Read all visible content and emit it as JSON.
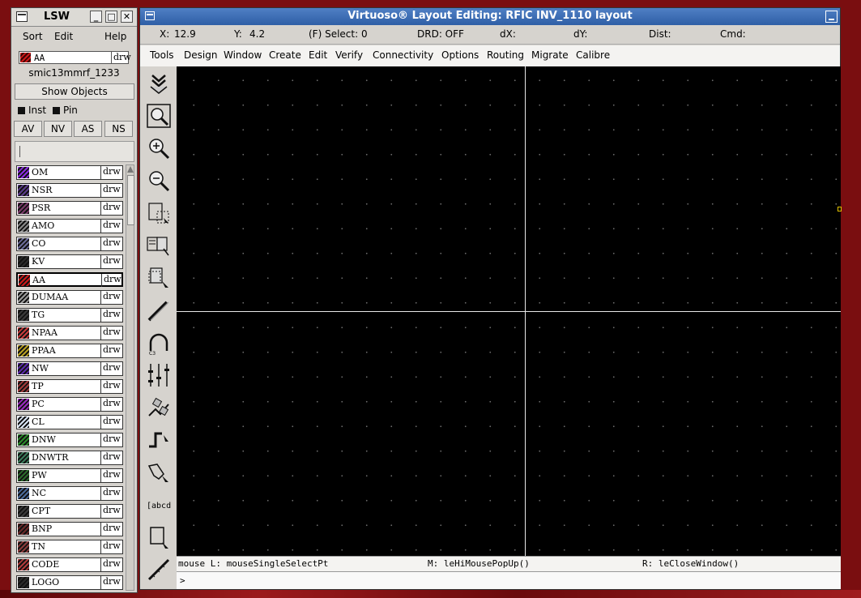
{
  "lsw": {
    "title": "LSW",
    "menu": {
      "sort": "Sort",
      "edit": "Edit",
      "help": "Help"
    },
    "current_layer": {
      "name": "AA",
      "purpose": "drw",
      "color": "#cc1a1a"
    },
    "library": "smic13mmrf_1233",
    "show_objects": "Show Objects",
    "checks": {
      "inst": "Inst",
      "pin": "Pin"
    },
    "visibility_buttons": {
      "av": "AV",
      "nv": "NV",
      "as": "AS",
      "ns": "NS"
    },
    "layers": [
      {
        "name": "OM",
        "purpose": "drw",
        "color": "#8a2be2",
        "selected": false
      },
      {
        "name": "NSR",
        "purpose": "drw",
        "color": "#5a3a8a",
        "selected": false
      },
      {
        "name": "PSR",
        "purpose": "drw",
        "color": "#7a3a6a",
        "selected": false
      },
      {
        "name": "AMO",
        "purpose": "drw",
        "color": "#888888",
        "selected": false
      },
      {
        "name": "CO",
        "purpose": "drw",
        "color": "#6a6a9a",
        "selected": false
      },
      {
        "name": "KV",
        "purpose": "drw",
        "color": "#2a2a2a",
        "selected": false
      },
      {
        "name": "AA",
        "purpose": "drw",
        "color": "#cc1a1a",
        "selected": true
      },
      {
        "name": "DUMAA",
        "purpose": "drw",
        "color": "#9a9a9a",
        "selected": false
      },
      {
        "name": "TG",
        "purpose": "drw",
        "color": "#3a3a3a",
        "selected": false
      },
      {
        "name": "NPAA",
        "purpose": "drw",
        "color": "#c83a3a",
        "selected": false
      },
      {
        "name": "PPAA",
        "purpose": "drw",
        "color": "#b8a020",
        "selected": false
      },
      {
        "name": "NW",
        "purpose": "drw",
        "color": "#5a2aaa",
        "selected": false
      },
      {
        "name": "TP",
        "purpose": "drw",
        "color": "#a03a3a",
        "selected": false
      },
      {
        "name": "PC",
        "purpose": "drw",
        "color": "#9a2ac0",
        "selected": false
      },
      {
        "name": "CL",
        "purpose": "drw",
        "color": "#d8e4f4",
        "selected": false
      },
      {
        "name": "DNW",
        "purpose": "drw",
        "color": "#2a8a2a",
        "selected": false
      },
      {
        "name": "DNWTR",
        "purpose": "drw",
        "color": "#3a7a5a",
        "selected": false
      },
      {
        "name": "PW",
        "purpose": "drw",
        "color": "#2a6a2a",
        "selected": false
      },
      {
        "name": "NC",
        "purpose": "drw",
        "color": "#4a6a9a",
        "selected": false
      },
      {
        "name": "CPT",
        "purpose": "drw",
        "color": "#3a3a3a",
        "selected": false
      },
      {
        "name": "BNP",
        "purpose": "drw",
        "color": "#6a2a2a",
        "selected": false
      },
      {
        "name": "TN",
        "purpose": "drw",
        "color": "#8a3a3a",
        "selected": false
      },
      {
        "name": "CODE",
        "purpose": "drw",
        "color": "#b03a3a",
        "selected": false
      },
      {
        "name": "LOGO",
        "purpose": "drw",
        "color": "#2a2a2a",
        "selected": false
      }
    ]
  },
  "main": {
    "title": "Virtuoso® Layout Editing: RFIC INV_1110 layout",
    "status": {
      "x_label": "X:",
      "x_value": "12.9",
      "y_label": "Y:",
      "y_value": "4.2",
      "select": "(F) Select: 0",
      "drd": "DRD: OFF",
      "dx": "dX:",
      "dy": "dY:",
      "dist": "Dist:",
      "cmd": "Cmd:"
    },
    "menu": [
      "Tools",
      "Design",
      "Window",
      "Create",
      "Edit",
      "Verify",
      "Connectivity",
      "Options",
      "Routing",
      "Migrate",
      "Calibre"
    ],
    "toolbar": [
      {
        "icon": "save-icon"
      },
      {
        "icon": "fit-icon"
      },
      {
        "icon": "zoom-in-icon"
      },
      {
        "icon": "zoom-out-icon"
      },
      {
        "icon": "stretch-icon"
      },
      {
        "icon": "copy-icon"
      },
      {
        "icon": "move-icon"
      },
      {
        "icon": "delete-icon"
      },
      {
        "icon": "undo-icon"
      },
      {
        "icon": "property-icon"
      },
      {
        "icon": "instance-icon"
      },
      {
        "icon": "path-icon"
      },
      {
        "icon": "polygon-icon"
      },
      {
        "icon": "label-icon",
        "text": "[abcd]"
      },
      {
        "icon": "rectangle-icon"
      },
      {
        "icon": "ruler-icon"
      }
    ],
    "mouse": {
      "left": "mouse L: mouseSingleSelectPt",
      "middle": "M: leHiMousePopUp()",
      "right": "R: leCloseWindow()"
    },
    "prompt": ">"
  }
}
